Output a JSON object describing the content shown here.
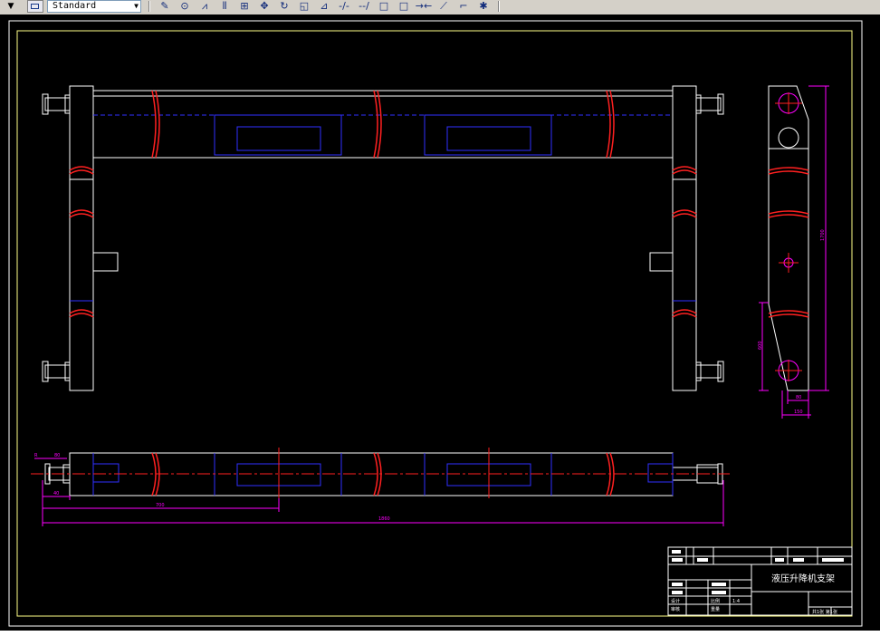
{
  "toolbar": {
    "text_style_value": "Standard",
    "buttons": [
      {
        "name": "edit-pencil-icon",
        "glyph": "✎"
      },
      {
        "name": "match-properties-icon",
        "glyph": "⊙"
      },
      {
        "name": "mirror-icon",
        "glyph": "⩘"
      },
      {
        "name": "offset-icon",
        "glyph": "⫴"
      },
      {
        "name": "array-icon",
        "glyph": "⊞"
      },
      {
        "name": "move-icon",
        "glyph": "✥"
      },
      {
        "name": "rotate-icon",
        "glyph": "↻"
      },
      {
        "name": "scale-icon",
        "glyph": "◱"
      },
      {
        "name": "stretch-icon",
        "glyph": "⊿"
      },
      {
        "name": "trim-icon",
        "glyph": "-/-"
      },
      {
        "name": "extend-icon",
        "glyph": "--/"
      },
      {
        "name": "break-icon",
        "glyph": "□"
      },
      {
        "name": "break-at-point-icon",
        "glyph": "□"
      },
      {
        "name": "join-icon",
        "glyph": "→←"
      },
      {
        "name": "chamfer-icon",
        "glyph": "⟋"
      },
      {
        "name": "fillet-icon",
        "glyph": "⌐"
      },
      {
        "name": "explode-icon",
        "glyph": "✱"
      }
    ]
  },
  "colors": {
    "background": "#000000",
    "object": "#ffffff",
    "hidden": "#0000ff",
    "break": "#ff0000",
    "centerline": "#ff0000",
    "dimension": "#ff00ff",
    "border": "#ffff88"
  },
  "drawing": {
    "title": "液压升降机支架",
    "dimensions": {
      "side_overall": "1700",
      "side_lower": "600",
      "side_width_small": "80",
      "side_width": "150",
      "bottom_overall": "1860",
      "bottom_partial": "700",
      "bottom_small_left": "40",
      "bottom_small_top": "80",
      "bottom_mark": "R"
    },
    "title_block": {
      "scale": "1:4",
      "sheet_info": "共1张 第1张",
      "row_labels": [
        "设计",
        "审核",
        "工艺",
        "标准化",
        "批准"
      ],
      "misc": [
        "比例",
        "重量",
        "数量"
      ]
    }
  }
}
